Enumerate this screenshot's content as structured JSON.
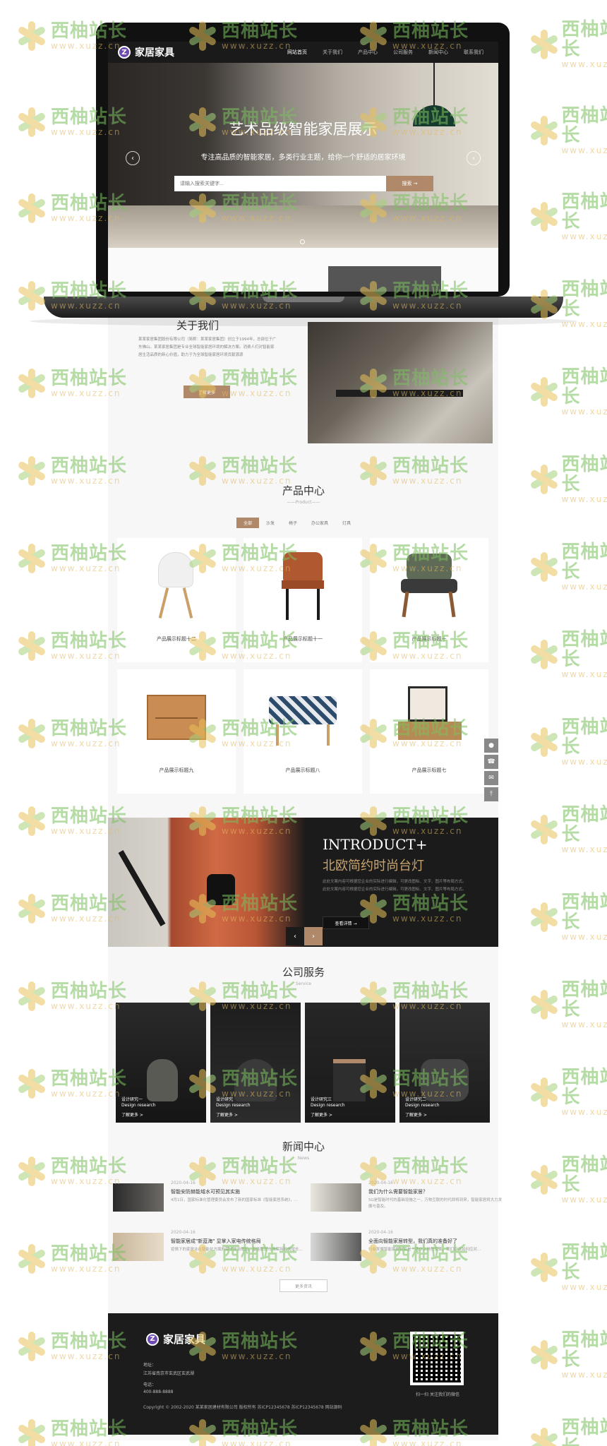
{
  "header": {
    "logo_mark": "Z",
    "logo_text": "家居家具",
    "nav": [
      "网站首页",
      "关于我们",
      "产品中心",
      "公司服务",
      "新闻中心",
      "联系我们"
    ]
  },
  "hero": {
    "title": "艺术品级智能家居展示",
    "subtitle": "专注高品质的智能家居，多类行业主题，给你一个舒适的居家环境",
    "search_placeholder": "请输入搜索关键字...",
    "search_button": "搜索 →",
    "prev": "‹",
    "next": "›"
  },
  "about": {
    "title": "关于我们",
    "text": "某某家居集团股份有限公司（简称：某某家居集团）创立于1994年，总部位于广东佛山。某某家居集团是专业全球智能家居环境的解决方案。消费人们对智能家居生活品质的新心价值，助力于为全球智能家居环境贡献源源",
    "button": "了解更多"
  },
  "products": {
    "title": "产品中心",
    "subtitle": "——Product——",
    "categories": [
      "全部",
      "沙发",
      "椅子",
      "办公家具",
      "灯具"
    ],
    "items": [
      "产品展示标题十二",
      "产品展示标题十一",
      "产品展示标题十",
      "产品展示标题九",
      "产品展示标题八",
      "产品展示标题七"
    ]
  },
  "banner": {
    "en": "INTRODUCT+",
    "cn": "北欧简约时尚台灯",
    "text": "此处文案内容可根据您企业的实际进行编辑，可更改图标、文字、图片等布局方式。此处文案内容可根据您企业的实际进行编辑，可更改图标、文字、图片等布局方式。",
    "more": "查看详情 →",
    "prev": "‹",
    "next": "›"
  },
  "services": {
    "title": "公司服务",
    "subtitle": "Service",
    "items": [
      {
        "cn": "设计研究一",
        "en": "Design research",
        "link": "了解更多 >"
      },
      {
        "cn": "设计研究",
        "en": "Design research",
        "link": "了解更多 >"
      },
      {
        "cn": "设计研究三",
        "en": "Design research",
        "link": "了解更多 >"
      },
      {
        "cn": "设计研究二",
        "en": "Design research",
        "link": "了解更多 >"
      }
    ]
  },
  "news": {
    "title": "新闻中心",
    "subtitle": "News",
    "items": [
      {
        "date": "2020-04-16",
        "title": "智能安防赫能域水可预见其实施",
        "desc": "4月1日，国家标准化管理委员会发布了新的国家标准《智能家居系统》，..."
      },
      {
        "date": "2020-04-16",
        "title": "我们为什么需要智能家居？",
        "desc": "5G是智能时代的基础设施之一，万物互联的时代即将到来，智能家居将大力发展与普及。"
      },
      {
        "date": "2020-04-16",
        "title": "智能家居成\"新蓝海\" 显掌入家电传统格局",
        "desc": "疫情下的家居业在智能化方面的需求逐渐增加，智能家居市场保持较快增长..."
      },
      {
        "date": "2020-04-16",
        "title": "全面向智能家居转型，我们真的准备好了",
        "desc": "行业发展智能家居到底是一场什么样的变革，我们应该如何应对..."
      }
    ],
    "more": "更多资讯"
  },
  "footer": {
    "logo_mark": "Z",
    "logo_text": "家居家具",
    "address_label": "地址：",
    "address": "江苏省南京市玄武区玄武湖",
    "phone_label": "电话：",
    "phone": "400-888-8888",
    "copyright": "Copyright © 2002-2020 某某家居建材有限公司 版权所有 苏ICP12345678 苏ICP12345678 网站源码",
    "qr_caption": "扫一扫 关注我们的微信"
  },
  "side_tools": [
    "●",
    "☎",
    "✉",
    "⤒"
  ],
  "watermark": {
    "cn": "西柚站长",
    "url": "www.xuzz.cn"
  }
}
